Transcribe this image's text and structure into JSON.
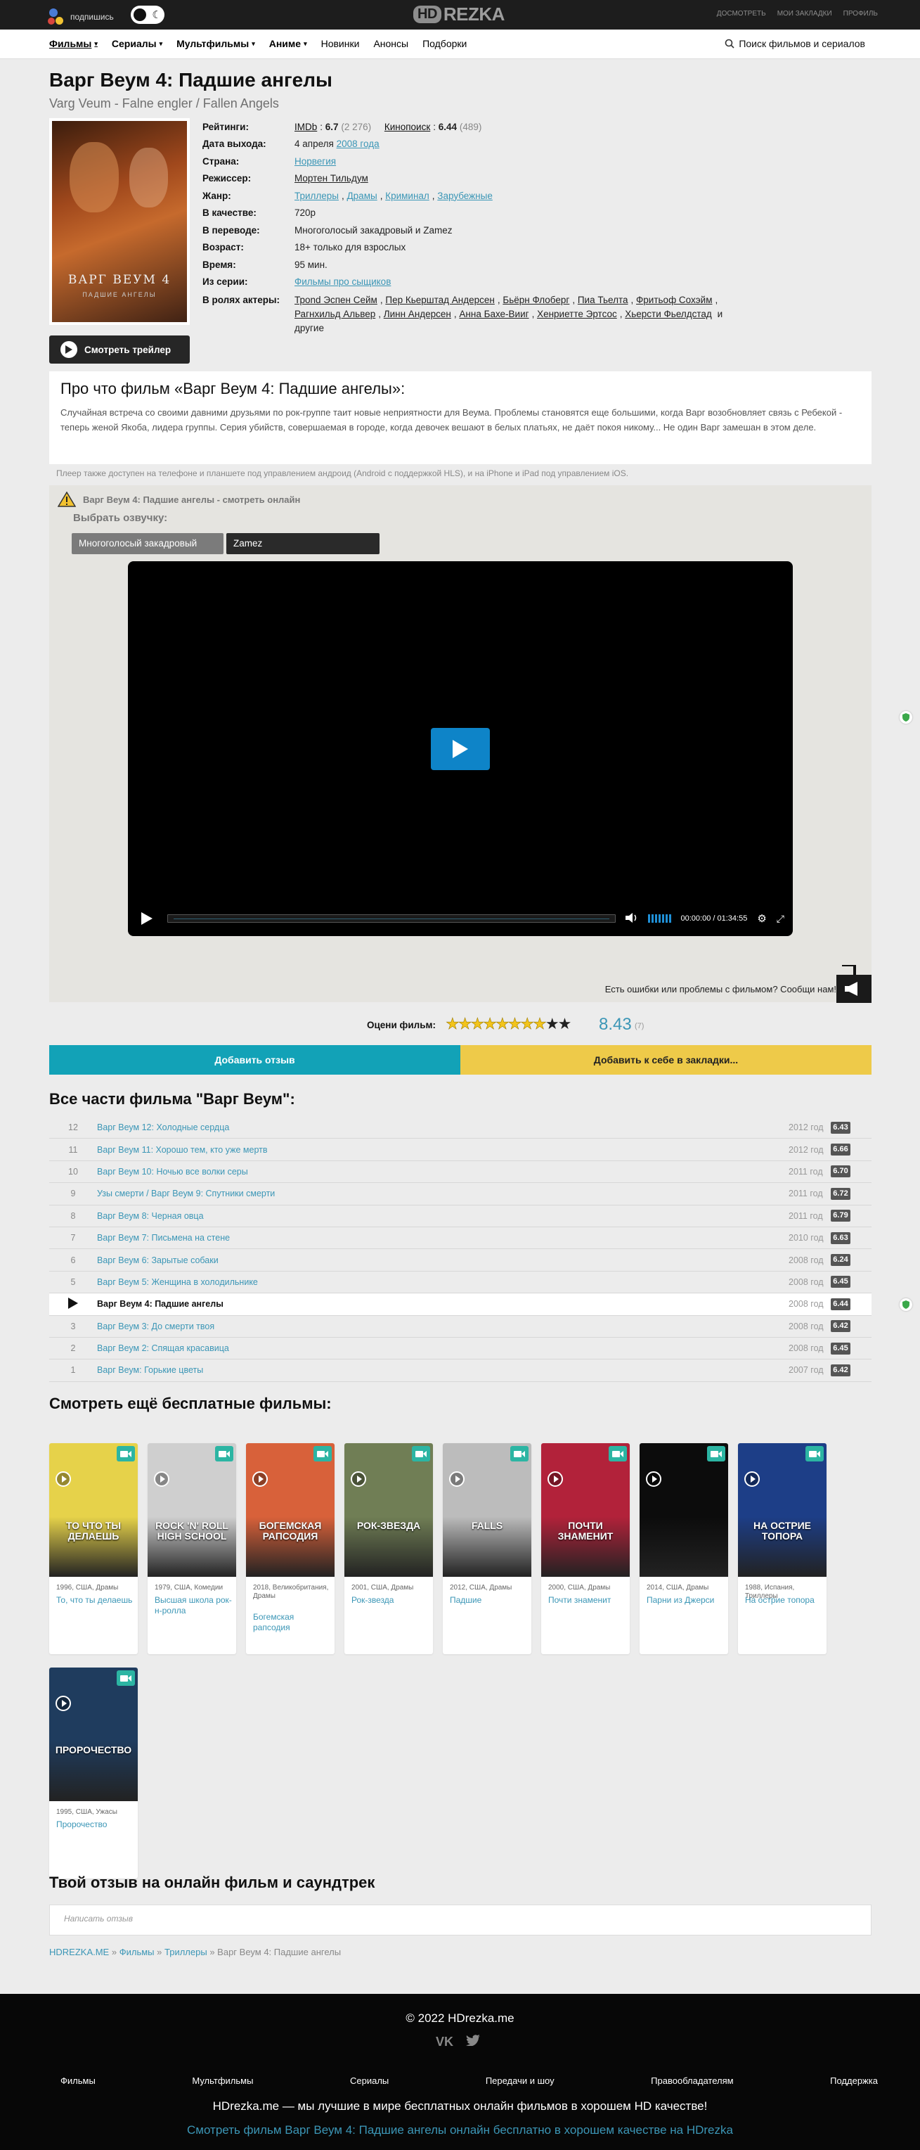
{
  "header": {
    "subscribe_label": "подпишись",
    "logo_left": "HD",
    "logo_right": "REZKA",
    "links": [
      "ДОСМОТРЕТЬ",
      "МОИ ЗАКЛАДКИ",
      "ПРОФИЛЬ"
    ]
  },
  "nav": {
    "items": [
      {
        "label": "Фильмы",
        "dropdown": true,
        "active": true
      },
      {
        "label": "Сериалы",
        "dropdown": true
      },
      {
        "label": "Мультфильмы",
        "dropdown": true
      },
      {
        "label": "Аниме",
        "dropdown": true
      },
      {
        "label": "Новинки"
      },
      {
        "label": "Анонсы"
      },
      {
        "label": "Подборки"
      }
    ],
    "search_label": "Поиск фильмов и сериалов"
  },
  "movie": {
    "title": "Варг Веум 4: Падшие ангелы",
    "original_title": "Varg Veum - Falne engler / Fallen Angels",
    "poster_title": "ВАРГ ВЕУМ 4",
    "poster_subtitle": "ПАДШИЕ АНГЕЛЫ",
    "info": {
      "ratings_label": "Рейтинги:",
      "imdb_label": "IMDb",
      "imdb_value": "6.7",
      "imdb_votes": "(2 276)",
      "kp_label": "Кинопоиск",
      "kp_value": "6.44",
      "kp_votes": "(489)",
      "release_label": "Дата выхода:",
      "release_date": "4 апреля",
      "release_year": "2008 года",
      "country_label": "Страна:",
      "country": "Норвегия",
      "director_label": "Режиссер:",
      "director": "Мортен Тильдум",
      "genre_label": "Жанр:",
      "genres": [
        "Триллеры",
        "Драмы",
        "Криминал",
        "Зарубежные"
      ],
      "quality_label": "В качестве:",
      "quality": "720p",
      "translation_label": "В переводе:",
      "translation": "Многоголосый закадровый и Zamez",
      "age_label": "Возраст:",
      "age": "18+ только для взрослых",
      "time_label": "Время:",
      "time": "95 мин.",
      "series_label": "Из серии:",
      "series": "Фильмы про сыщиков",
      "actors_label": "В ролях актеры:",
      "actors": [
        "Трond Эспен Сейм",
        "Пер Кьерштад Андерсен",
        "Бьёрн Флоберг",
        "Пиа Тьелта",
        "Фритьоф Сохэйм",
        "Рагнхильд Альвер",
        "Линн Андерсен",
        "Анна Бахе-Вииг",
        "Хенриетте Эртсос",
        "Хьерсти Фьелдстад"
      ],
      "actors_more": "и другие"
    },
    "trailer_label": "Смотреть трейлер"
  },
  "about": {
    "title": "Про что фильм «Варг Веум 4: Падшие ангелы»:",
    "text": "Случайная встреча со своими давними друзьями по рок-группе таит новые неприятности для Веума. Проблемы становятся еще большими, когда Варг возобновляет связь с Ребекой - теперь женой Якоба, лидера группы. Серия убийств, совершаемая в городе, когда девочек вешают в белых платьях, не даёт покоя никому... Не один Варг замешан в этом деле."
  },
  "player": {
    "note": "Плеер также доступен на телефоне и планшете под управлением андроид (Android с поддержкой HLS), и на iPhone и iPad под управлением iOS.",
    "warning": "Варг Веум 4: Падшие ангелы - смотреть онлайн",
    "voice_label": "Выбрать озвучку:",
    "voices": [
      "Многоголосый закадровый",
      "Zamez"
    ],
    "time_current": "00:00:00",
    "time_total": "01:34:55",
    "report_text": "Есть ошибки или проблемы с фильмом? Сообщи нам!"
  },
  "rating": {
    "label": "Оцени фильм:",
    "value": "8.43",
    "count": "(7)",
    "filled_stars": 8,
    "total_stars": 10
  },
  "actions": {
    "review": "Добавить отзыв",
    "bookmark": "Добавить к себе в закладки..."
  },
  "parts": {
    "title": "Все части фильма \"Варг Веум\":",
    "items": [
      {
        "num": "12",
        "name": "Варг Веум 12: Холодные сердца",
        "year": "2012 год",
        "score": "6.43"
      },
      {
        "num": "11",
        "name": "Варг Веум 11: Хорошо тем, кто уже мертв",
        "year": "2012 год",
        "score": "6.66"
      },
      {
        "num": "10",
        "name": "Варг Веум 10: Ночью все волки серы",
        "year": "2011 год",
        "score": "6.70"
      },
      {
        "num": "9",
        "name": "Узы смерти / Варг Веум 9: Спутники смерти",
        "year": "2011 год",
        "score": "6.72"
      },
      {
        "num": "8",
        "name": "Варг Веум 8: Черная овца",
        "year": "2011 год",
        "score": "6.79"
      },
      {
        "num": "7",
        "name": "Варг Веум 7: Письмена на стене",
        "year": "2010 год",
        "score": "6.63"
      },
      {
        "num": "6",
        "name": "Варг Веум 6: Зарытые собаки",
        "year": "2008 год",
        "score": "6.24"
      },
      {
        "num": "5",
        "name": "Варг Веум 5: Женщина в холодильнике",
        "year": "2008 год",
        "score": "6.45"
      },
      {
        "num": "",
        "name": "Варг Веум 4: Падшие ангелы",
        "year": "2008 год",
        "score": "6.44",
        "current": true
      },
      {
        "num": "3",
        "name": "Варг Веум 3: До смерти твоя",
        "year": "2008 год",
        "score": "6.42"
      },
      {
        "num": "2",
        "name": "Варг Веум 2: Спящая красавица",
        "year": "2008 год",
        "score": "6.45"
      },
      {
        "num": "1",
        "name": "Варг Веум: Горькие цветы",
        "year": "2007 год",
        "score": "6.42"
      }
    ]
  },
  "more": {
    "title": "Смотреть ещё бесплатные фильмы:",
    "cards": [
      {
        "meta": "1996, США, Драмы",
        "name": "То, что ты делаешь",
        "poster_text": "ТО ЧТО ТЫ ДЕЛАЕШЬ",
        "color": "#e6d24a"
      },
      {
        "meta": "1979, США, Комедии",
        "name": "Высшая школа рок-н-ролла",
        "poster_text": "ROCK 'N' ROLL HIGH SCHOOL",
        "color": "#cfcfcf"
      },
      {
        "meta": "2018, Великобритания, Драмы",
        "name": "Богемская рапсодия",
        "poster_text": "БОГЕМСКАЯ РАПСОДИЯ",
        "color": "#d8613a"
      },
      {
        "meta": "2001, США, Драмы",
        "name": "Рок-звезда",
        "poster_text": "РОК-ЗВЕЗДА",
        "color": "#707e55"
      },
      {
        "meta": "2012, США, Драмы",
        "name": "Падшие",
        "poster_text": "FALLS",
        "color": "#bcbcbc"
      },
      {
        "meta": "2000, США, Драмы",
        "name": "Почти знаменит",
        "poster_text": "ПОЧТИ ЗНАМЕНИТ",
        "color": "#b2223a"
      },
      {
        "meta": "2014, США, Драмы",
        "name": "Парни из Джерси",
        "poster_text": "",
        "color": "#0c0c0c"
      },
      {
        "meta": "1988, Испания, Триллеры",
        "name": "На острие топора",
        "poster_text": "НА ОСТРИЕ ТОПОРА",
        "color": "#1d3e87"
      },
      {
        "meta": "1995, США, Ужасы",
        "name": "Пророчество",
        "poster_text": "ПРОРОЧЕСТВО",
        "color": "#1f3c5e"
      }
    ]
  },
  "review_form": {
    "title": "Твой отзыв на онлайн фильм и саундтрек",
    "placeholder": "Написать отзыв"
  },
  "breadcrumb": {
    "items": [
      "HDREZKA.ME",
      "Фильмы",
      "Триллеры"
    ],
    "current": "Варг Веум 4: Падшие ангелы",
    "separator": "»"
  },
  "footer": {
    "copyright": "© 2022 HDrezka.me",
    "social": [
      "VK",
      "Twitter"
    ],
    "links": [
      "Фильмы",
      "Мультфильмы",
      "Сериалы",
      "Передачи и шоу",
      "Правообладателям",
      "Поддержка"
    ],
    "tagline": "HDrezka.me — мы лучшие в мире бесплатных онлайн фильмов в хорошем HD качестве!",
    "seo_link": "Смотреть фильм Варг Веум 4: Падшие ангелы онлайн бесплатно в хорошем качестве на HDrezka"
  },
  "colors": {
    "accent": "#3b96b6",
    "review_button": "#12a2b7",
    "bookmark_button": "#eeca49",
    "play_button": "#0e84c8",
    "top_bar": "#1d1d1d"
  }
}
